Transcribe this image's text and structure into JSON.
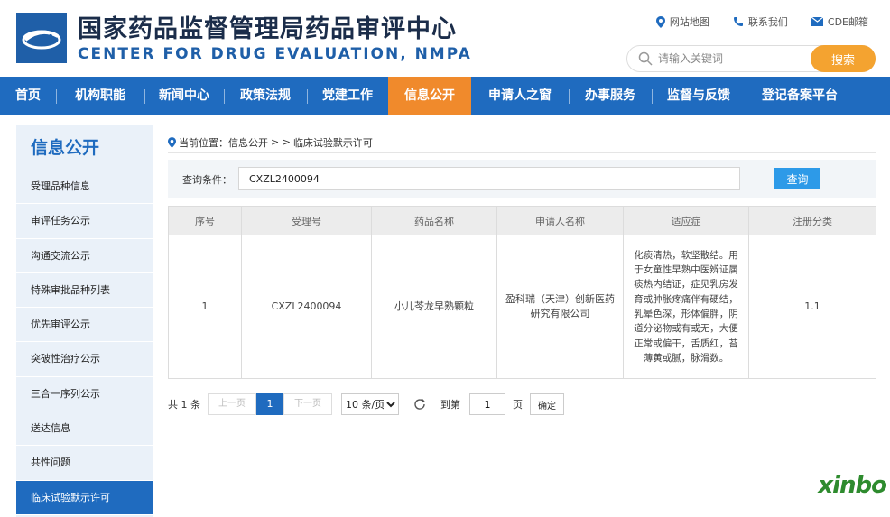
{
  "header": {
    "title_cn": "国家药品监督管理局药品审评中心",
    "title_en": "CENTER FOR DRUG EVALUATION, NMPA",
    "links": [
      "网站地图",
      "联系我们",
      "CDE邮箱"
    ],
    "search_placeholder": "请输入关键词",
    "search_button": "搜索"
  },
  "nav": {
    "items": [
      "首页",
      "机构职能",
      "新闻中心",
      "政策法规",
      "党建工作",
      "信息公开",
      "申请人之窗",
      "办事服务",
      "监督与反馈",
      "登记备案平台"
    ],
    "active_index": 5
  },
  "sidebar": {
    "title": "信息公开",
    "items": [
      "受理品种信息",
      "审评任务公示",
      "沟通交流公示",
      "特殊审批品种列表",
      "优先审评公示",
      "突破性治疗公示",
      "三合一序列公示",
      "送达信息",
      "共性问题",
      "临床试验默示许可"
    ],
    "active_index": 9
  },
  "breadcrumb": {
    "label": "当前位置：信息公开",
    "sep": ">  >",
    "current": "临床试验默示许可"
  },
  "query": {
    "label": "查询条件：",
    "value": "CXZL2400094",
    "button": "查询"
  },
  "table": {
    "headers": [
      "序号",
      "受理号",
      "药品名称",
      "申请人名称",
      "适应症",
      "注册分类"
    ],
    "rows": [
      [
        "1",
        "CXZL2400094",
        "小儿苓龙早熟颗粒",
        "盈科瑞（天津）创新医药研究有限公司",
        "化痰清热，软坚散结。用于女童性早熟中医辨证属痰热内结证，症见乳房发育或肿胀疼痛伴有硬结，乳晕色深，形体偏胖，阴道分泌物或有或无，大便正常或偏干，舌质红，苔薄黄或腻，脉滑数。",
        "1.1"
      ]
    ]
  },
  "pager": {
    "total": "共 1 条",
    "prev": "上一页",
    "current_page": "1",
    "next": "下一页",
    "page_size": "10 条/页",
    "goto_label": "到第",
    "goto_value": "1",
    "page_unit": "页",
    "ok": "确定"
  },
  "watermark": "xinbo"
}
